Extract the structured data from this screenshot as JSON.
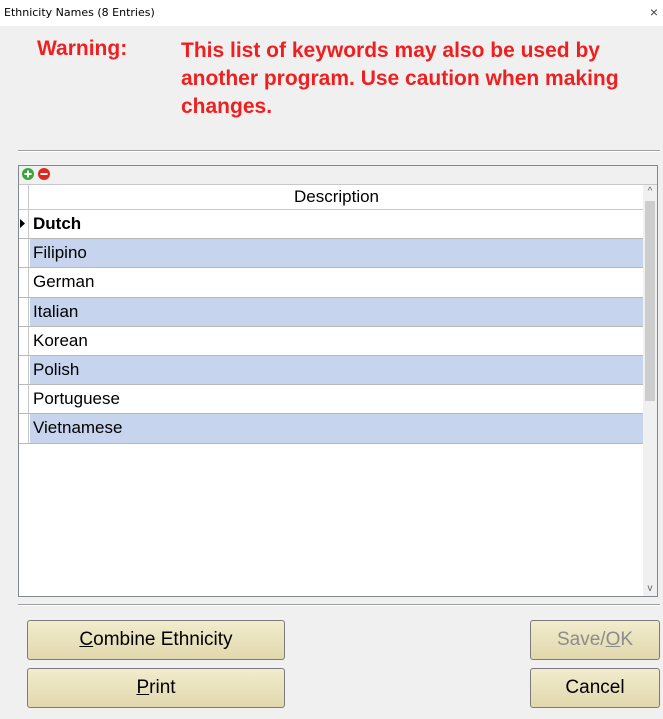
{
  "window": {
    "title": "Ethnicity Names (8 Entries)",
    "close_glyph": "×"
  },
  "warning": {
    "label": "Warning:",
    "message": "This list of keywords may also be used by another program. Use caution when making changes.",
    "color": "#f01f1f"
  },
  "grid": {
    "toolbar_icons": [
      "add-icon",
      "remove-icon"
    ],
    "column_header": "Description",
    "row_colors": {
      "normal": "#ffffff",
      "alternate": "#c6d4ee"
    },
    "rows": [
      {
        "label": "Dutch"
      },
      {
        "label": "Filipino"
      },
      {
        "label": "German"
      },
      {
        "label": "Italian"
      },
      {
        "label": "Korean"
      },
      {
        "label": "Polish"
      },
      {
        "label": "Portuguese"
      },
      {
        "label": "Vietnamese"
      }
    ],
    "scroll_up_glyph": "^",
    "scroll_down_glyph": "v"
  },
  "buttons": {
    "combine": {
      "mnemonic": "C",
      "rest": "ombine Ethnicity"
    },
    "print": {
      "mnemonic": "P",
      "rest": "rint"
    },
    "save_ok": {
      "before": "Save/",
      "mnemonic": "O",
      "rest": "K",
      "enabled": false
    },
    "cancel": {
      "label": "Cancel"
    },
    "color": "#e9e2bf"
  }
}
